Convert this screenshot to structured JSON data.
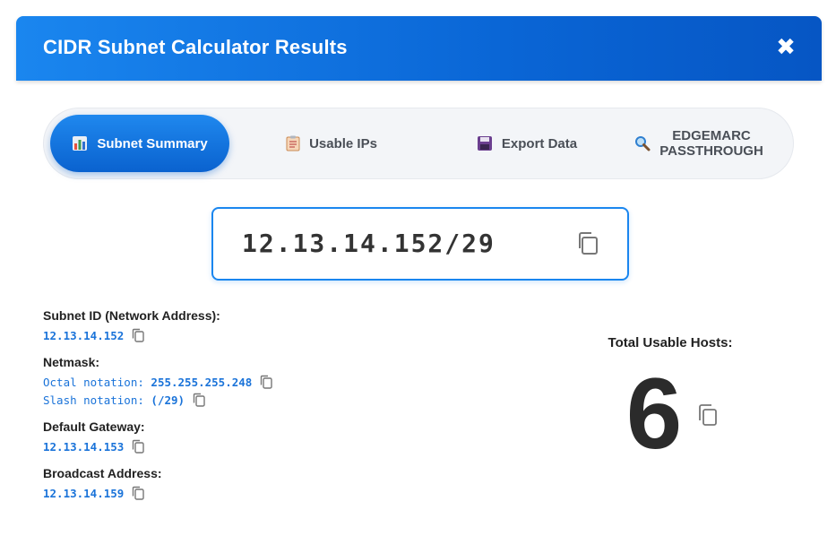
{
  "header": {
    "title": "CIDR Subnet Calculator Results",
    "close_label": "✖"
  },
  "tabs": [
    {
      "label": "Subnet Summary",
      "icon": "bar-chart-icon",
      "active": true
    },
    {
      "label": "Usable IPs",
      "icon": "clipboard-icon",
      "active": false
    },
    {
      "label": "Export Data",
      "icon": "floppy-disk-icon",
      "active": false
    },
    {
      "label_line1": "EDGEMARC",
      "label_line2": "PASSTHROUGH",
      "icon": "magnifier-icon",
      "active": false
    }
  ],
  "cidr": {
    "value": "12.13.14.152/29",
    "copy_icon": "copy-icon"
  },
  "details": {
    "subnet_id": {
      "label": "Subnet ID (Network Address):",
      "value": "12.13.14.152"
    },
    "netmask": {
      "label": "Netmask:",
      "octal_prefix": "Octal notation: ",
      "octal_value": "255.255.255.248",
      "slash_prefix": "Slash notation: ",
      "slash_value": "(/29)"
    },
    "gateway": {
      "label": "Default Gateway:",
      "value": "12.13.14.153"
    },
    "broadcast": {
      "label": "Broadcast Address:",
      "value": "12.13.14.159"
    }
  },
  "hosts": {
    "label": "Total Usable Hosts:",
    "value": "6"
  },
  "colors": {
    "accent": "#1a86ef",
    "header_dark": "#0656c4",
    "link": "#1a73d9",
    "text": "#222222"
  }
}
